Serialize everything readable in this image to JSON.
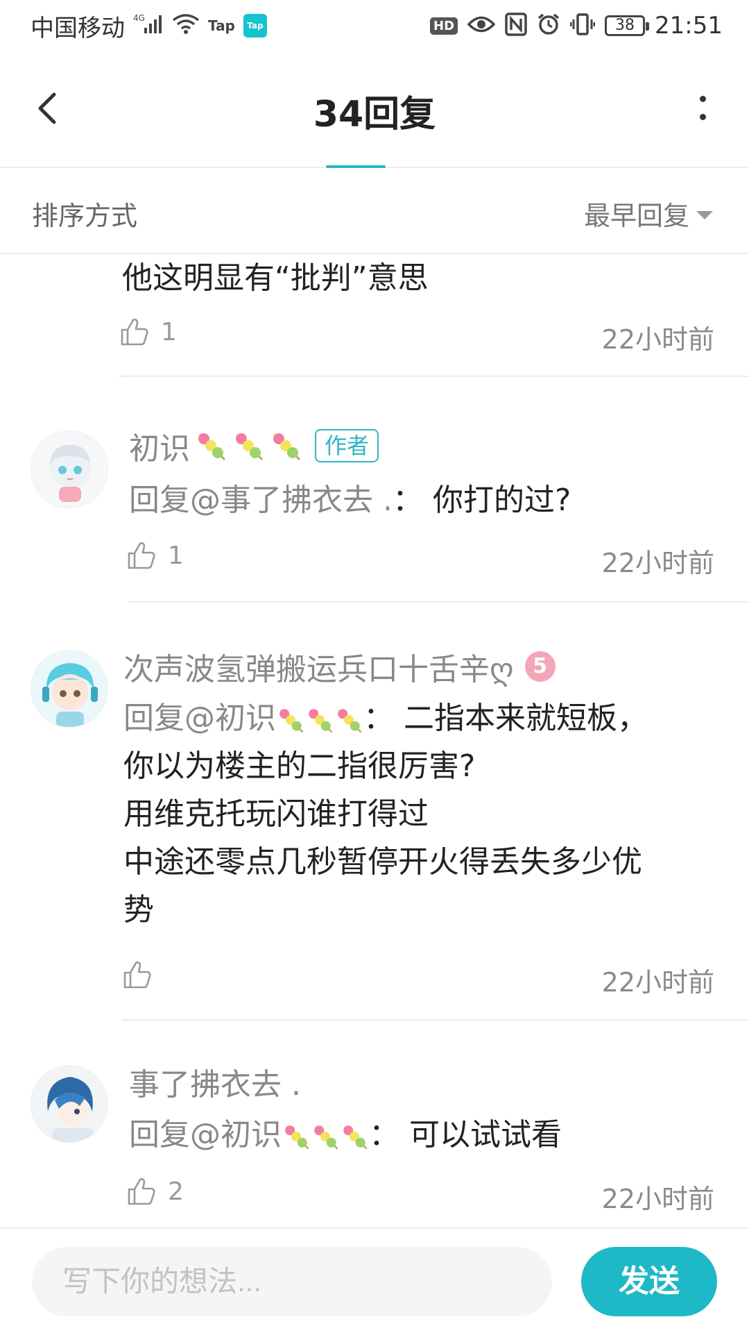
{
  "status_bar": {
    "carrier": "中国移动",
    "network": "4G",
    "tap_label": "Tap",
    "tap_badge": "Tap",
    "hd": "HD",
    "battery": "38",
    "time": "21:51"
  },
  "header": {
    "title": "34回复"
  },
  "sort": {
    "label": "排序方式",
    "value": "最早回复"
  },
  "comments": [
    {
      "text": "他这明显有“批判”意思",
      "likes": "1",
      "time": "22小时前"
    },
    {
      "name": "初识",
      "badge": "作者",
      "mention": "回复@事了拂衣去 .",
      "body": "： 你打的过?",
      "likes": "1",
      "time": "22小时前"
    },
    {
      "name": "次声波氢弹搬运兵口十舌辛ღ",
      "level": "5",
      "mention": "回复@初识",
      "lines": [
        "： 二指本来就短板，",
        "你以为楼主的二指很厉害?",
        "用维克托玩闪谁打得过",
        "中途还零点几秒暂停开火得丢失多少优",
        "势"
      ],
      "likes": "",
      "time": "22小时前"
    },
    {
      "name": "事了拂衣去 .",
      "mention": "回复@初识",
      "body": "： 可以试试看",
      "likes": "2",
      "time": "22小时前"
    }
  ],
  "input": {
    "placeholder": "写下你的想法..."
  },
  "send_label": "发送",
  "colors": {
    "accent": "#1fb8c6",
    "muted_text": "#888888"
  },
  "icons": [
    "back-icon",
    "more-icon",
    "like-icon",
    "dango-emoji",
    "wifi-icon",
    "signal-icon",
    "eye-icon",
    "nfc-icon",
    "alarm-icon",
    "vibrate-icon",
    "battery-icon"
  ]
}
